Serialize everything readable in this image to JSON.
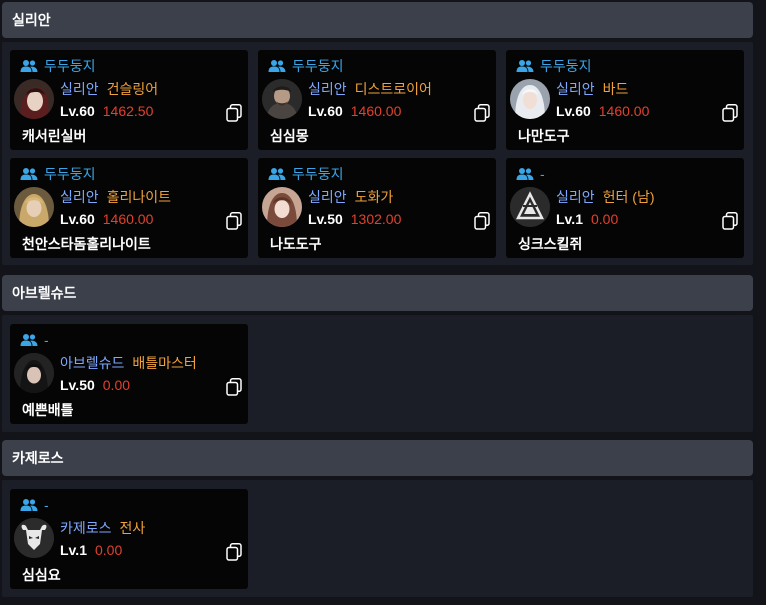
{
  "colors": {
    "page_bg": "#121419",
    "section_header_bg": "#3c404b",
    "section_body_bg": "#1b1e26",
    "card_bg": "#050505",
    "guild_text": "#3aa6e8",
    "server_text": "#7fa8ff",
    "class_text": "#f0a23c",
    "item_level_text": "#e2412d"
  },
  "sections": [
    {
      "title": "실리안",
      "characters": [
        {
          "guild": "두두둥지",
          "server": "실리안",
          "class": "건슬링어",
          "level": "Lv.60",
          "item_level": "1462.50",
          "name": "캐서린실버",
          "avatar": "portrait-gunslinger"
        },
        {
          "guild": "두두둥지",
          "server": "실리안",
          "class": "디스트로이어",
          "level": "Lv.60",
          "item_level": "1460.00",
          "name": "심심몽",
          "avatar": "portrait-destroyer"
        },
        {
          "guild": "두두둥지",
          "server": "실리안",
          "class": "바드",
          "level": "Lv.60",
          "item_level": "1460.00",
          "name": "나만도구",
          "avatar": "portrait-bard"
        },
        {
          "guild": "두두둥지",
          "server": "실리안",
          "class": "홀리나이트",
          "level": "Lv.60",
          "item_level": "1460.00",
          "name": "천안스타돔홀리나이트",
          "avatar": "portrait-holyknight"
        },
        {
          "guild": "두두둥지",
          "server": "실리안",
          "class": "도화가",
          "level": "Lv.50",
          "item_level": "1302.00",
          "name": "나도도구",
          "avatar": "portrait-artist"
        },
        {
          "guild": "-",
          "server": "실리안",
          "class": "헌터 (남)",
          "level": "Lv.1",
          "item_level": "0.00",
          "name": "싱크스킬쥐",
          "avatar": "hunter-emblem-icon"
        }
      ]
    },
    {
      "title": "아브렐슈드",
      "characters": [
        {
          "guild": "-",
          "server": "아브렐슈드",
          "class": "배틀마스터",
          "level": "Lv.50",
          "item_level": "0.00",
          "name": "예쁜배틀",
          "avatar": "portrait-battlemaster"
        }
      ]
    },
    {
      "title": "카제로스",
      "characters": [
        {
          "guild": "-",
          "server": "카제로스",
          "class": "전사",
          "level": "Lv.1",
          "item_level": "0.00",
          "name": "심심요",
          "avatar": "warrior-emblem-icon"
        }
      ]
    }
  ]
}
